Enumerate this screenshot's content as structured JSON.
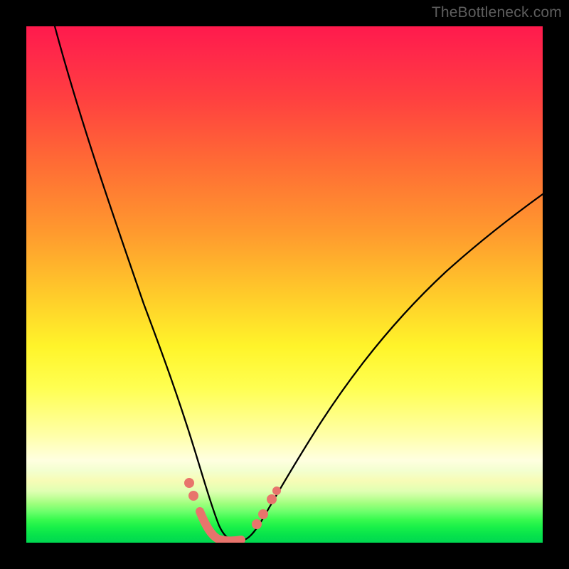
{
  "watermark": {
    "text": "TheBottleneck.com"
  },
  "chart_data": {
    "type": "line",
    "title": "",
    "xlabel": "",
    "ylabel": "",
    "xlim": [
      0,
      100
    ],
    "ylim": [
      0,
      100
    ],
    "grid": false,
    "background_gradient": {
      "stops": [
        {
          "pos": 0.0,
          "color": "#ff1a4d"
        },
        {
          "pos": 0.4,
          "color": "#ff9a2e"
        },
        {
          "pos": 0.62,
          "color": "#fff42a"
        },
        {
          "pos": 0.84,
          "color": "#ffffe0"
        },
        {
          "pos": 1.0,
          "color": "#00d851"
        }
      ]
    },
    "series": [
      {
        "name": "left_branch",
        "x": [
          5,
          10,
          15,
          20,
          25,
          28,
          31,
          33.5,
          36,
          38
        ],
        "y": [
          100,
          81,
          63,
          46,
          30,
          21,
          13,
          7,
          3,
          0.5
        ]
      },
      {
        "name": "right_branch",
        "x": [
          42,
          44,
          47,
          52,
          58,
          66,
          76,
          88,
          100
        ],
        "y": [
          0.5,
          3,
          7,
          14,
          22,
          32,
          43,
          53,
          62
        ]
      }
    ],
    "highlight_segments": [
      {
        "name": "left_lower_salmon",
        "color": "#e8746c",
        "points": [
          {
            "x": 31.3,
            "y": 11.0
          },
          {
            "x": 32.3,
            "y": 8.6
          },
          {
            "x": 33.6,
            "y": 5.6
          },
          {
            "x": 35.0,
            "y": 2.9
          },
          {
            "x": 36.5,
            "y": 1.2
          },
          {
            "x": 38.0,
            "y": 0.6
          },
          {
            "x": 40.0,
            "y": 0.5
          },
          {
            "x": 41.5,
            "y": 0.7
          }
        ]
      },
      {
        "name": "right_lower_salmon",
        "color": "#e8746c",
        "points": [
          {
            "x": 44.5,
            "y": 3.2
          },
          {
            "x": 45.7,
            "y": 5.1
          },
          {
            "x": 47.3,
            "y": 7.9
          },
          {
            "x": 48.3,
            "y": 9.6
          }
        ]
      }
    ]
  }
}
